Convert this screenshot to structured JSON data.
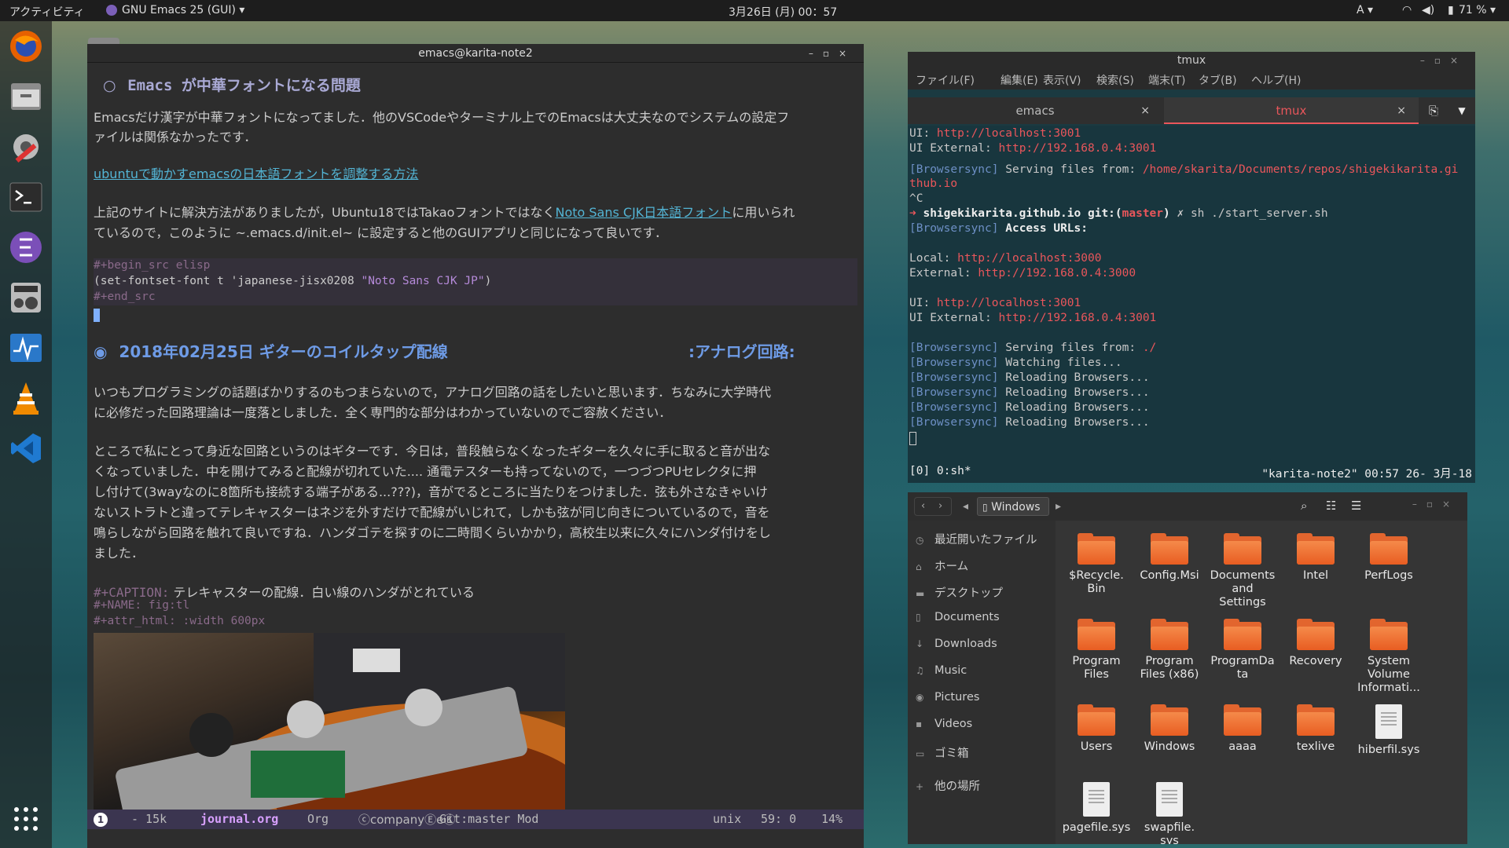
{
  "topbar": {
    "activities": "アクティビティ",
    "app_menu": "GNU Emacs 25 (GUI) ▾",
    "clock": "3月26日 (月) 00：57",
    "input_method": "A ▾",
    "battery": "71 % ▾"
  },
  "emacs": {
    "window_title": "emacs@karita-note2",
    "heading1_bullet": "○",
    "heading1_text": "Emacs が中華フォントになる問題",
    "para1_line1": "Emacsだけ漢字が中華フォントになってました．他のVSCodeやターミナル上でのEmacsは大丈夫なのでシステムの設定フ",
    "para1_line2": "ァイルは関係なかったです．",
    "link1": "ubuntuで動かすemacsの日本語フォントを調整する方法",
    "para2_line1_a": "上記のサイトに解決方法がありましたが，Ubuntu18ではTakaoフォントではなく",
    "para2_link": "Noto Sans CJK日本語フォント",
    "para2_line1_b": "に用いられ",
    "para2_line2": "ているので，このように ~.emacs.d/init.el~ に設定すると他のGUIアプリと同じになって良いです．",
    "src_begin": "#+begin_src elisp",
    "src_code_a": "(set-fontset-font t 'japanese-jisx0208 ",
    "src_code_str": "\"Noto Sans CJK JP\"",
    "src_code_b": ")",
    "src_end": "#+end_src",
    "heading2_bullet": "◉",
    "heading2_text": "2018年02月25日 ギターのコイルタップ配線",
    "heading2_tag": ":アナログ回路:",
    "para3_line1": "いつもプログラミングの話題ばかりするのもつまらないので，アナログ回路の話をしたいと思います．ちなみに大学時代",
    "para3_line2": "に必修だった回路理論は一度落としました．全く専門的な部分はわかっていないのでご容赦ください．",
    "para4_line1": "ところで私にとって身近な回路というのはギターです．今日は，普段触らなくなったギターを久々に手に取ると音が出な",
    "para4_line2": "くなっていました．中を開けてみると配線が切れていた.... 通電テスターも持ってないので，一つづつPUセレクタに押",
    "para4_line3": "し付けて(3wayなのに8箇所も接続する端子がある...???)，音がでるところに当たりをつけました．弦も外さなきゃいけ",
    "para4_line4": "ないストラトと違ってテレキャスターはネジを外すだけで配線がいじれて，しかも弦が同じ向きについているので，音を",
    "para4_line5": "鳴らしながら回路を触れて良いですね．ハンダゴテを探すのに二時間くらいかかり，高校生以来に久々にハンダ付けをし",
    "para4_line6": "ました．",
    "caption_key": "#+CAPTION:",
    "caption_text": " テレキャスターの配線．白い線のハンダがとれている",
    "name_line": "#+NAME: fig:tl",
    "attr_line": "#+attr_html: :width 600px",
    "modeline": {
      "number": "1",
      "size": "- 15k",
      "buffer": "journal.org",
      "mode": "Org",
      "minor": "ⓒcompanyⒺeⓀ",
      "vc": "Git:master Mod",
      "eol": "unix",
      "position": "59: 0",
      "percent": "14%"
    }
  },
  "terminal": {
    "window_title": "tmux",
    "menus": [
      "ファイル(F)",
      "編集(E)",
      "表示(V)",
      "検索(S)",
      "端末(T)",
      "タブ(B)",
      "ヘルプ(H)"
    ],
    "tabs": [
      "emacs",
      "tmux"
    ],
    "lines": {
      "l1_label": "      UI: ",
      "l1_url": "http://localhost:3001",
      "l2_label": " UI External: ",
      "l2_url": "http://192.168.0.4:3001",
      "l3_tag": "[Browsersync]",
      "l3_text": " Serving files from: ",
      "l3_path": "/home/skarita/Documents/repos/shigekikarita.gi",
      "l4_path": "thub.io",
      "l5": "^C",
      "l6_arrow": "➜",
      "l6_repo": "  shigekikarita.github.io",
      "l6_git": " git:(",
      "l6_branch": "master",
      "l6_git2": ")",
      "l6_cmd": " ✗ sh ./start_server.sh",
      "l7_tag": "[Browsersync]",
      "l7_text": " Access URLs:",
      "l8_label": "       Local: ",
      "l8_url": "http://localhost:3000",
      "l9_label": "    External: ",
      "l9_url": "http://192.168.0.4:3000",
      "l10_label": "          UI: ",
      "l10_url": "http://localhost:3001",
      "l11_label": " UI External: ",
      "l11_url": "http://192.168.0.4:3001",
      "l12_tag": "[Browsersync]",
      "l12_text": " Serving files from: ",
      "l12_path": "./",
      "l13_tag": "[Browsersync]",
      "l13_text": " Watching files...",
      "l14_tag": "[Browsersync]",
      "l14_text": " Reloading Browsers...",
      "l15_tag": "[Browsersync]",
      "l15_text": " Reloading Browsers...",
      "l16_tag": "[Browsersync]",
      "l16_text": " Reloading Browsers...",
      "l17_tag": "[Browsersync]",
      "l17_text": " Reloading Browsers..."
    },
    "status_left": "[0] 0:sh*",
    "status_right": "\"karita-note2\" 00:57 26- 3月-18"
  },
  "files": {
    "location": "Windows",
    "sidebar": [
      "最近開いたファイル",
      "ホーム",
      "デスクトップ",
      "Documents",
      "Downloads",
      "Music",
      "Pictures",
      "Videos",
      "ゴミ箱",
      "他の場所"
    ],
    "items": [
      {
        "name": "$Recycle.\nBin",
        "kind": "folder"
      },
      {
        "name": "Config.Msi",
        "kind": "folder"
      },
      {
        "name": "Documents\nand\nSettings",
        "kind": "folder"
      },
      {
        "name": "Intel",
        "kind": "folder"
      },
      {
        "name": "PerfLogs",
        "kind": "folder"
      },
      {
        "name": "Program\nFiles",
        "kind": "folder"
      },
      {
        "name": "Program\nFiles (x86)",
        "kind": "folder"
      },
      {
        "name": "ProgramDa\nta",
        "kind": "folder"
      },
      {
        "name": "Recovery",
        "kind": "folder"
      },
      {
        "name": "System\nVolume\nInformati...",
        "kind": "folder"
      },
      {
        "name": "Users",
        "kind": "folder"
      },
      {
        "name": "Windows",
        "kind": "folder"
      },
      {
        "name": "aaaa",
        "kind": "folder"
      },
      {
        "name": "texlive",
        "kind": "folder"
      },
      {
        "name": "hiberfil.sys",
        "kind": "file"
      },
      {
        "name": "pagefile.sys",
        "kind": "file"
      },
      {
        "name": "swapfile.\nsys",
        "kind": "file"
      }
    ]
  },
  "colors": {
    "accent_red": "#e9565b",
    "folder_orange": "#e85d22",
    "modeline_bg": "#3b3550"
  }
}
